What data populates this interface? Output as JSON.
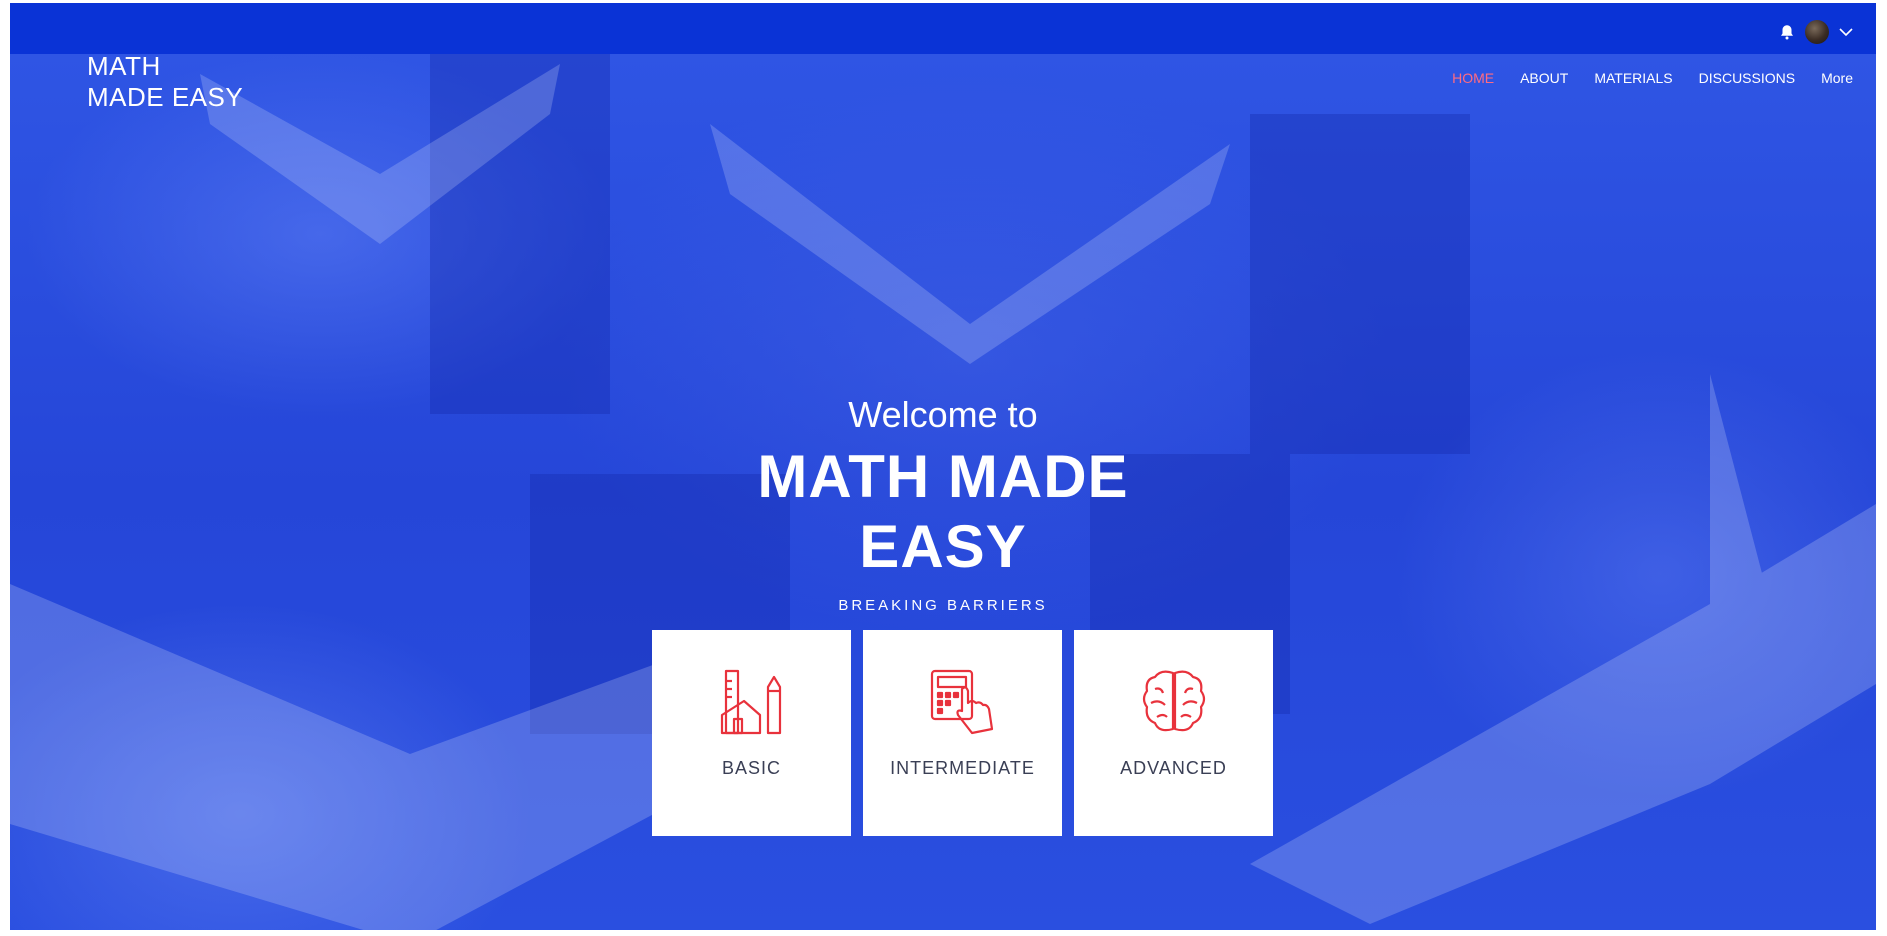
{
  "brand": {
    "line1": "MATH",
    "line2": "MADE EASY"
  },
  "nav": {
    "items": [
      {
        "label": "HOME",
        "active": true
      },
      {
        "label": "ABOUT"
      },
      {
        "label": "MATERIALS"
      },
      {
        "label": "DISCUSSIONS"
      },
      {
        "label": "More"
      }
    ]
  },
  "topbar": {
    "icons": [
      "bell-icon",
      "avatar",
      "chevron-down-icon"
    ]
  },
  "hero": {
    "welcome": "Welcome to",
    "title_line1": "MATH MADE",
    "title_line2": "EASY",
    "tagline": "BREAKING BARRIERS"
  },
  "cards": [
    {
      "label": "BASIC",
      "icon": "ruler-pencil-house-icon"
    },
    {
      "label": "INTERMEDIATE",
      "icon": "calculator-hand-icon"
    },
    {
      "label": "ADVANCED",
      "icon": "brain-icon"
    }
  ],
  "colors": {
    "topbar": "#0a33d6",
    "hero_overlay": "#2b4ee0",
    "nav_active": "#ff6b81",
    "card_icon": "#e8323c",
    "card_text": "#3a3f55"
  }
}
